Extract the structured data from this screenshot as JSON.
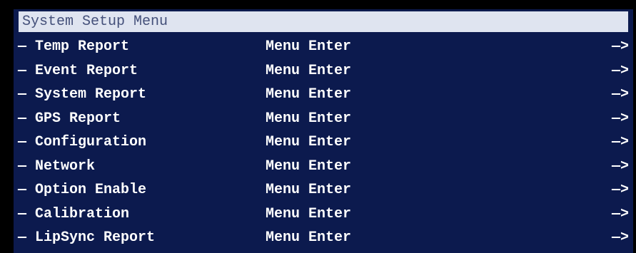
{
  "menu": {
    "title": "System Setup Menu",
    "items": [
      {
        "label": "— Temp Report",
        "action": "Menu Enter",
        "arrow": "—>"
      },
      {
        "label": "— Event Report",
        "action": "Menu Enter",
        "arrow": "—>"
      },
      {
        "label": "— System Report",
        "action": "Menu Enter",
        "arrow": "—>"
      },
      {
        "label": "— GPS Report",
        "action": "Menu Enter",
        "arrow": "—>"
      },
      {
        "label": "— Configuration",
        "action": "Menu Enter",
        "arrow": "—>"
      },
      {
        "label": "— Network",
        "action": "Menu Enter",
        "arrow": "—>"
      },
      {
        "label": "— Option Enable",
        "action": "Menu Enter",
        "arrow": "—>"
      },
      {
        "label": "— Calibration",
        "action": "Menu Enter",
        "arrow": "—>"
      },
      {
        "label": "— LipSync Report",
        "action": "Menu Enter",
        "arrow": "—>"
      }
    ]
  },
  "colors": {
    "background": "#0c1a4e",
    "title_bar": "#dfe4f0",
    "title_text": "#44507a",
    "item_text": "#ffffff"
  }
}
